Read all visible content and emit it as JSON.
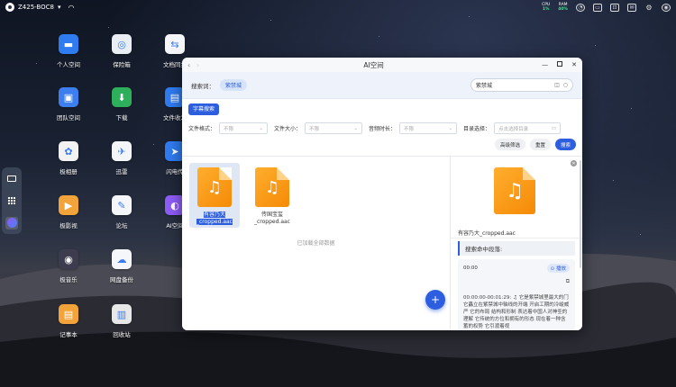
{
  "topbar": {
    "device": "Z425-BOC8",
    "cpu_label": "CPU",
    "cpu_value": "1%",
    "ram_label": "RAM",
    "ram_value": "40%"
  },
  "desktop": {
    "icons": [
      {
        "label": "个人空间",
        "icon": "folder-icon",
        "color": "#2f7cf0"
      },
      {
        "label": "团队空间",
        "icon": "team-folder-icon",
        "color": "#3e7ff0"
      },
      {
        "label": "极相册",
        "icon": "photos-icon",
        "color": "#f2f2f2"
      },
      {
        "label": "极影视",
        "icon": "video-icon",
        "color": "#f2a43b"
      },
      {
        "label": "极音乐",
        "icon": "music-icon",
        "color": "#3c3c4e"
      },
      {
        "label": "记事本",
        "icon": "notepad-icon",
        "color": "#f2a43b"
      },
      {
        "label": "保险箱",
        "icon": "safe-icon",
        "color": "#e9eef5"
      },
      {
        "label": "下载",
        "icon": "download-icon",
        "color": "#2eaf5c"
      },
      {
        "label": "迅雷",
        "icon": "thunder-icon",
        "color": "#f4f6fa"
      },
      {
        "label": "论坛",
        "icon": "forum-icon",
        "color": "#f4f6fa"
      },
      {
        "label": "网盘备份",
        "icon": "cloud-backup-icon",
        "color": "#f4f6fa"
      },
      {
        "label": "回收站",
        "icon": "trash-icon",
        "color": "#e7e7e7"
      },
      {
        "label": "文档同步",
        "icon": "sync-icon",
        "color": "#f4f6fa"
      },
      {
        "label": "文件收发",
        "icon": "file-transfer-icon",
        "color": "#2f7cf0"
      },
      {
        "label": "闪电传",
        "icon": "flash-transfer-icon",
        "color": "#2f7cf0"
      },
      {
        "label": "AI空间",
        "icon": "ai-space-icon",
        "color": "#8e5cf7"
      }
    ]
  },
  "window": {
    "title": "AI空间",
    "search": {
      "keyword_label": "搜索词：",
      "chip": "紫禁城",
      "value": "紫禁城"
    },
    "tab": "字幕搜索",
    "filters": [
      {
        "label": "文件格式：",
        "placeholder": "不限"
      },
      {
        "label": "文件大小：",
        "placeholder": "不限"
      },
      {
        "label": "音频时长：",
        "placeholder": "不限"
      },
      {
        "label": "目录选择：",
        "placeholder": "点击选择目录"
      }
    ],
    "buttons": {
      "advanced": "高级筛选",
      "reset": "重置",
      "search": "搜索"
    },
    "files": [
      {
        "line1": "有容乃大",
        "line2": "_cropped.aac"
      },
      {
        "line1": "传国宝玺",
        "line2": "_cropped.aac"
      }
    ],
    "loaded_all": "已加载全部数据",
    "detail": {
      "file_name": "有容乃大_cropped.aac",
      "hits_title": "搜索命中段落:",
      "time": "00:00",
      "play": "播放",
      "segment_time": "00:00:00-00:01:29:",
      "segment_text": "它是紫禁城里最大的门 它矗立在紫禁城中轴线的开端 开启工期的冷峻威严 它的布局 结构和形制 表达着中国人对神圣的理解 它传统的方位和拥有的形态 现在着一种含蓄的权势 它引渡着视"
    }
  }
}
